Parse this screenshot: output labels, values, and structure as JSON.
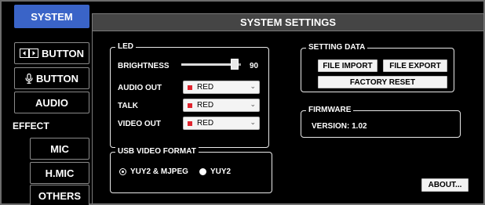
{
  "sidebar": {
    "system_label": "SYSTEM",
    "button_label": "BUTTON",
    "mic_button_label": "BUTTON",
    "audio_label": "AUDIO",
    "effect_heading": "EFFECT",
    "mic_label": "MIC",
    "hmic_label": "H.MIC",
    "others_label": "OTHERS"
  },
  "main": {
    "title": "SYSTEM SETTINGS",
    "led": {
      "title": "LED",
      "brightness_label": "BRIGHTNESS",
      "brightness_value": "90",
      "brightness_level": 0.9,
      "audio_out_label": "AUDIO OUT",
      "audio_out_value": "RED",
      "talk_label": "TALK",
      "talk_value": "RED",
      "video_out_label": "VIDEO OUT",
      "video_out_value": "RED",
      "swatch_color": "#e0242e"
    },
    "setting_data": {
      "title": "SETTING DATA",
      "file_import": "FILE IMPORT",
      "file_export": "FILE EXPORT",
      "factory_reset": "FACTORY RESET"
    },
    "firmware": {
      "title": "FIRMWARE",
      "version": "VERSION: 1.02"
    },
    "usb_video_format": {
      "title": "USB VIDEO FORMAT",
      "option_yuy2_mjpeg": "YUY2 & MJPEG",
      "option_yuy2": "YUY2",
      "selected": "YUY2 & MJPEG"
    },
    "about_label": "ABOUT..."
  },
  "colors": {
    "accent": "#3a64c8",
    "title_bar": "#454545"
  }
}
